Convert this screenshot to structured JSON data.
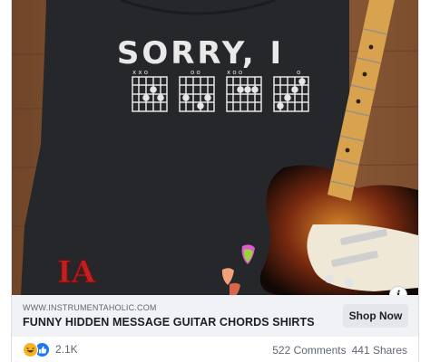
{
  "post": {
    "image": {
      "shirt_text": "SORRY, I",
      "logo_text": "IA",
      "chords": [
        "x x o",
        "o o",
        "x o o",
        "o"
      ]
    },
    "link": {
      "domain": "WWW.INSTRUMENTAHOLIC.COM",
      "headline": "FUNNY HIDDEN MESSAGE GUITAR CHORDS SHIRTS",
      "cta_label": "Shop Now"
    },
    "info_icon_label": "i",
    "footer": {
      "reaction_count": "2.1K",
      "comments": "522 Comments",
      "shares": "441 Shares"
    }
  },
  "colors": {
    "wood": "#8a5a36",
    "shirt": "#26272b",
    "link_bar": "#f0f2f5",
    "like_blue": "#1877f2",
    "haha_yellow": "#f7b125",
    "logo_red": "#c0201f"
  },
  "icons": [
    "info-icon",
    "haha-reaction-icon",
    "like-reaction-icon",
    "guitar-picks-icon"
  ]
}
